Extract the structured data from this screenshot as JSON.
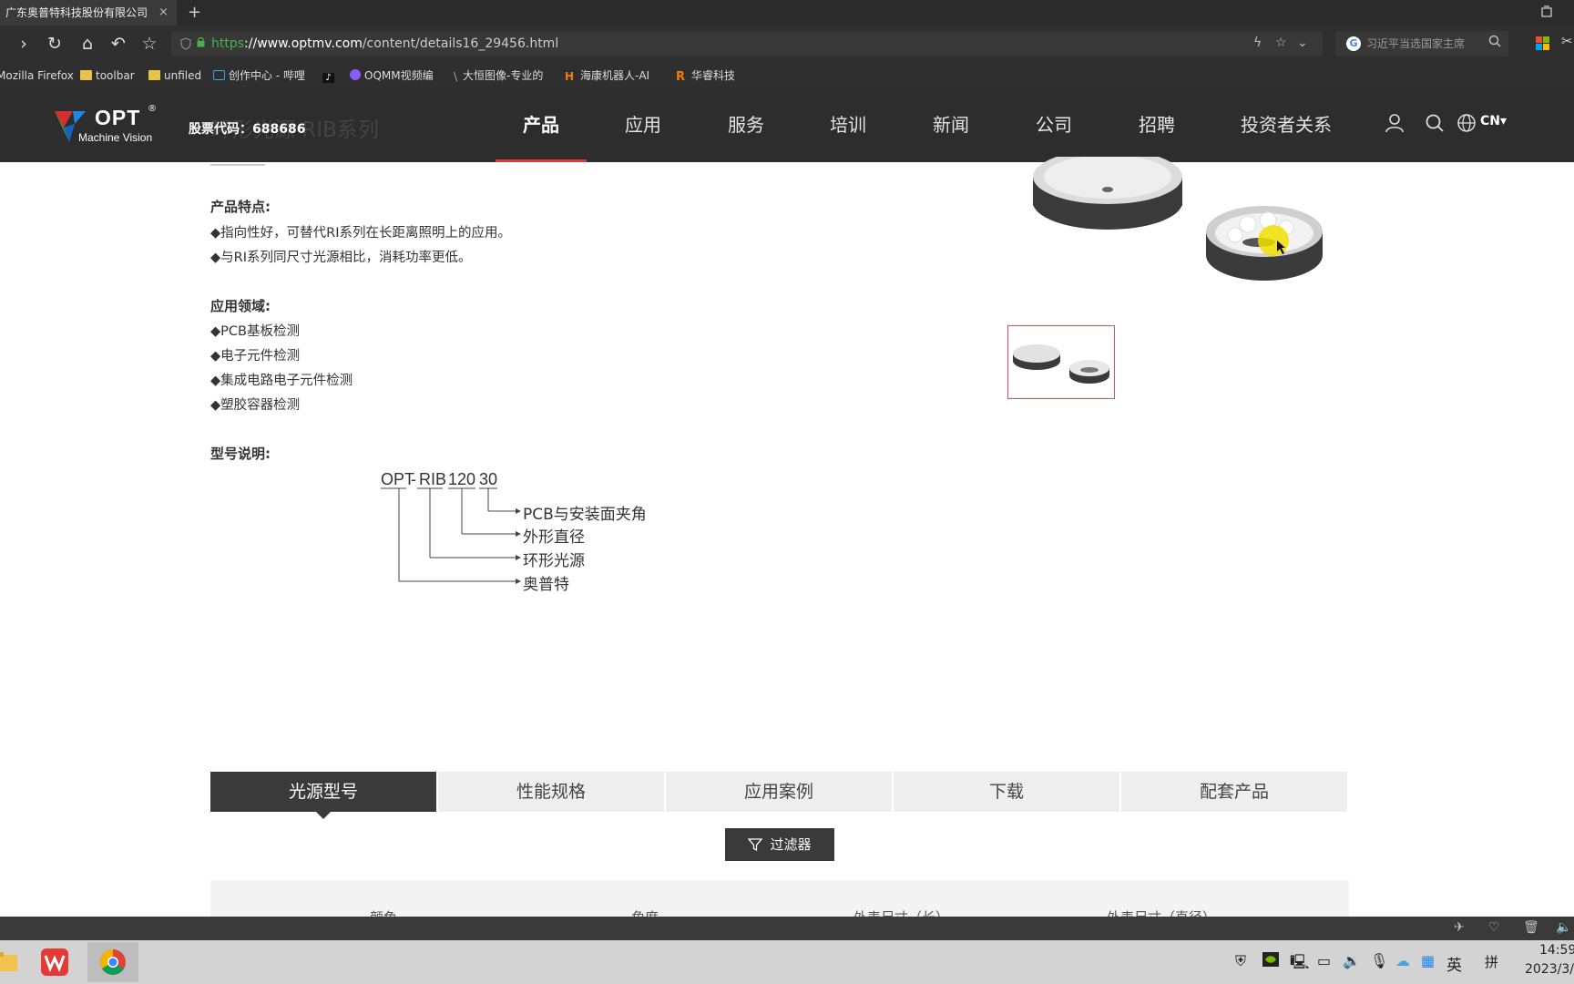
{
  "browser": {
    "tab_title": "广东奥普特科技股份有限公司",
    "tab_close": "×",
    "new_tab": "+",
    "url_scheme": "https",
    "url_host": "://www.optmv.com",
    "url_path": "/content/details16_29456.html",
    "search_placeholder": "习近平当选国家主席",
    "search_engine_glyph": "G",
    "bookmarks": [
      {
        "label": "Mozilla Firefox",
        "icon": "none"
      },
      {
        "label": "toolbar",
        "icon": "folder-icon"
      },
      {
        "label": "unfiled",
        "icon": "folder-icon"
      },
      {
        "label": "创作中心 - 哔哩",
        "icon": "bilibili-icon"
      },
      {
        "label": "",
        "icon": "tiktok-icon"
      },
      {
        "label": "OQMM视频编",
        "icon": "oqmm-icon"
      },
      {
        "label": "大恒图像-专业的",
        "icon": "daheng-icon"
      },
      {
        "label": "海康机器人-AI",
        "icon": "hikrobot-icon"
      },
      {
        "label": "华睿科技",
        "icon": "huarui-icon"
      }
    ]
  },
  "site": {
    "logo_text": "OPT",
    "logo_reg": "®",
    "logo_sub": "Machine Vision",
    "stock_code": "股票代码：688686",
    "page_title": "环形光源 RIB系列",
    "nav": [
      "产品",
      "应用",
      "服务",
      "培训",
      "新闻",
      "公司",
      "招聘",
      "投资者关系"
    ],
    "lang": "CN▾"
  },
  "content": {
    "features_heading": "产品特点:",
    "features": [
      "◆指向性好，可替代RI系列在长距离照明上的应用。",
      "◆与RI系列同尺寸光源相比，消耗功率更低。"
    ],
    "applications_heading": "应用领域:",
    "applications": [
      "◆PCB基板检测",
      "◆电子元件检测",
      "◆集成电路电子元件检测",
      "◆塑胶容器检测"
    ],
    "model_heading": "型号说明:",
    "model_code_parts": [
      "OPT",
      "-",
      "RIB",
      "120",
      "30"
    ],
    "model_labels": [
      "PCB与安装面夹角",
      "外形直径",
      "环形光源",
      "奥普特"
    ]
  },
  "tabs": [
    "光源型号",
    "性能规格",
    "应用案例",
    "下载",
    "配套产品"
  ],
  "filter_label": "过滤器",
  "table_headers": [
    "颜色",
    "角度",
    "外表尺寸（长）",
    "外表尺寸（直径）"
  ],
  "taskbar": {
    "clock_time": "14:59",
    "clock_date": "2023/3/",
    "ime_lang": "英",
    "ime_mode": "拼"
  }
}
